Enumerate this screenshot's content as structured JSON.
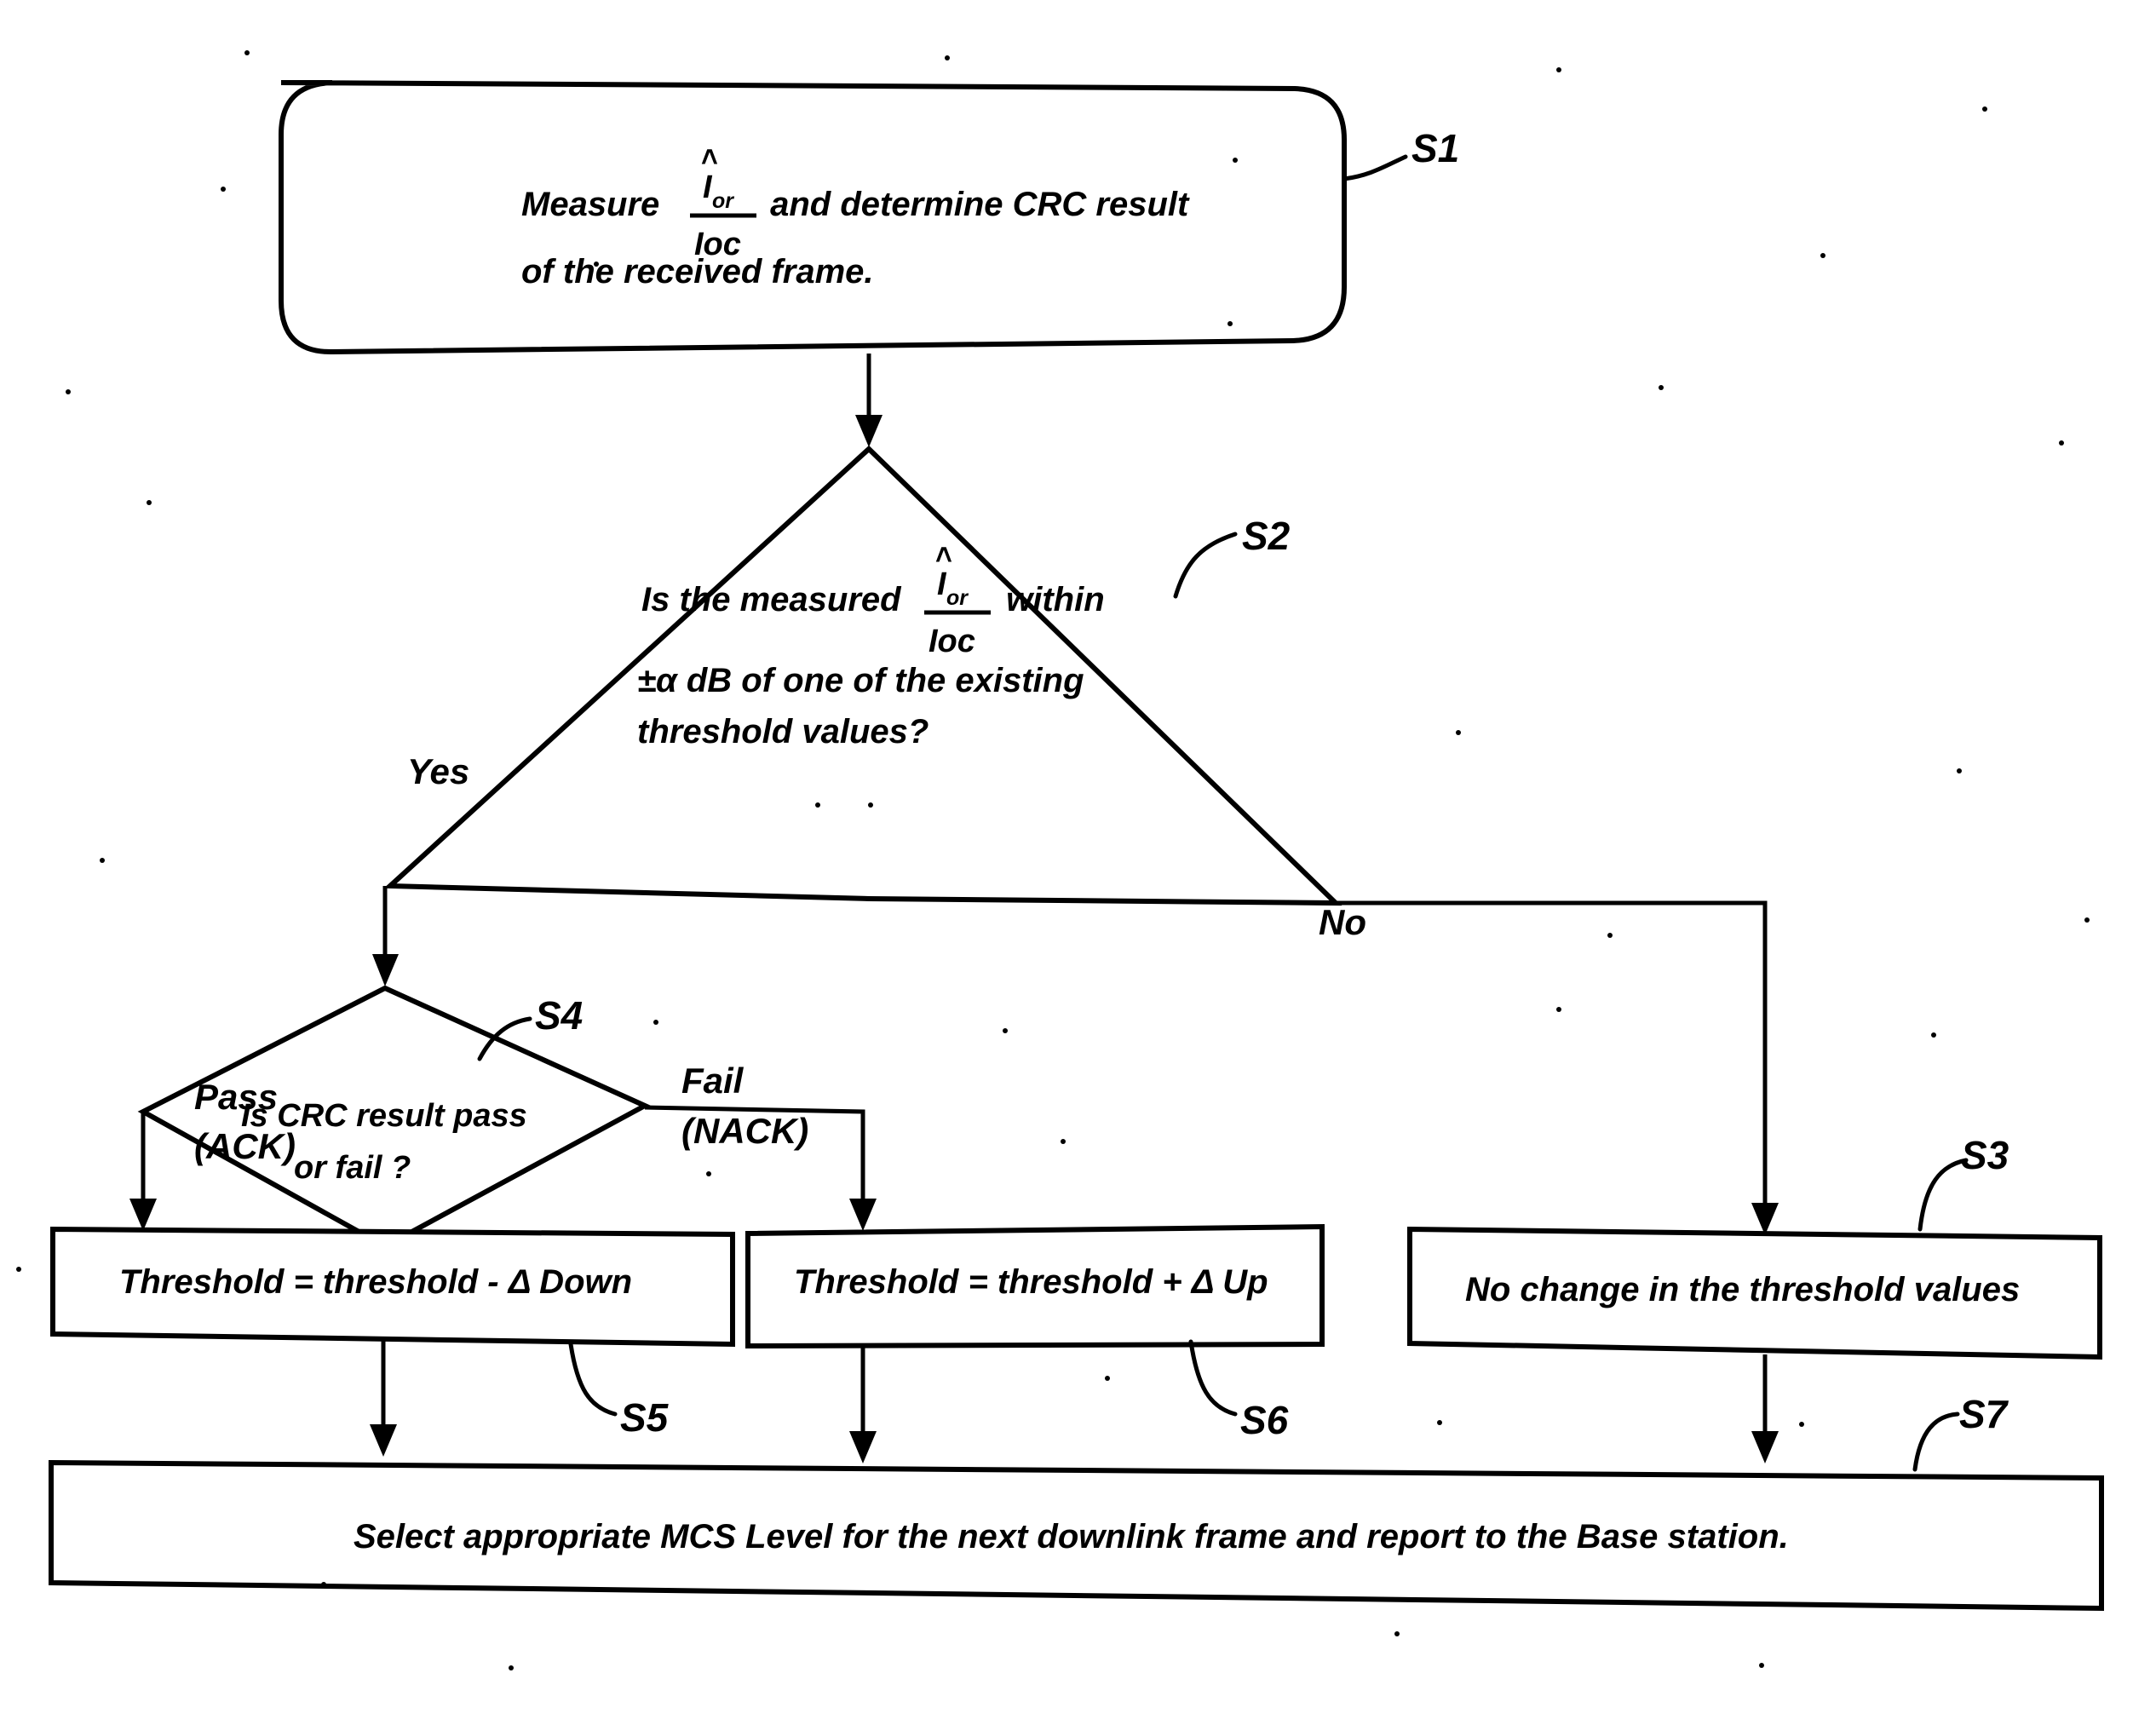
{
  "diagram": {
    "kind": "flowchart",
    "title_present": false,
    "nodes": [
      {
        "id": "S1",
        "step_label": "S1",
        "shape": "rounded-rectangle",
        "lines": [
          {
            "pre": "Measure ",
            "fraction": {
              "numerator": "I",
              "numerator_sub": "or",
              "numerator_hat": true,
              "denominator": "Ioc"
            },
            "post": " and determine CRC result"
          },
          {
            "pre": "of the received frame.",
            "fraction": null,
            "post": ""
          }
        ],
        "plain_text": "Measure Îor/Ioc and determine CRC result of the received frame."
      },
      {
        "id": "S2",
        "step_label": "S2",
        "shape": "diamond",
        "lines": [
          {
            "pre": "Is the measured ",
            "fraction": {
              "numerator": "I",
              "numerator_sub": "or",
              "numerator_hat": true,
              "denominator": "Ioc"
            },
            "post": " within"
          },
          {
            "pre": "±α dB of one of the existing",
            "fraction": null,
            "post": ""
          },
          {
            "pre": "threshold values?",
            "fraction": null,
            "post": ""
          }
        ],
        "plain_text": "Is the measured Îor/Ioc within ±α dB of one of the existing threshold values?"
      },
      {
        "id": "S4",
        "step_label": "S4",
        "shape": "diamond",
        "lines": [
          {
            "pre": "Is CRC result pass",
            "fraction": null,
            "post": ""
          },
          {
            "pre": "or fail ?",
            "fraction": null,
            "post": ""
          }
        ],
        "plain_text": "Is CRC result pass or fail ?"
      },
      {
        "id": "S5",
        "step_label": "S5",
        "shape": "rectangle",
        "lines": [
          {
            "pre": "Threshold = threshold - Δ Down",
            "fraction": null,
            "post": ""
          }
        ],
        "plain_text": "Threshold = threshold - Δ Down"
      },
      {
        "id": "S6",
        "step_label": "S6",
        "shape": "rectangle",
        "lines": [
          {
            "pre": "Threshold = threshold + Δ Up",
            "fraction": null,
            "post": ""
          }
        ],
        "plain_text": "Threshold = threshold + Δ Up"
      },
      {
        "id": "S3",
        "step_label": "S3",
        "shape": "rectangle",
        "lines": [
          {
            "pre": "No change in the threshold values",
            "fraction": null,
            "post": ""
          }
        ],
        "plain_text": "No change in the threshold values"
      },
      {
        "id": "S7",
        "step_label": "S7",
        "shape": "rectangle",
        "lines": [
          {
            "pre": "Select appropriate MCS Level for the next downlink frame and report to the Base station.",
            "fraction": null,
            "post": ""
          }
        ],
        "plain_text": "Select appropriate MCS Level for the next downlink frame and report to the Base station."
      }
    ],
    "edge_labels": {
      "s2_yes": "Yes",
      "s2_no": "No",
      "s4_pass_line1": "Pass",
      "s4_pass_line2": "(ACK)",
      "s4_fail_line1": "Fail",
      "s4_fail_line2": "(NACK)"
    },
    "step_labels": {
      "s1": "S1",
      "s2": "S2",
      "s3": "S3",
      "s4": "S4",
      "s5": "S5",
      "s6": "S6",
      "s7": "S7"
    },
    "text_pieces": {
      "s1_pre": "Measure ",
      "s1_post": " and determine CRC result",
      "s1_line2": "of the received frame.",
      "s2_pre": "Is the measured ",
      "s2_post": " within",
      "s2_line2": "±α dB of one of the existing",
      "s2_line3": "threshold values?",
      "s4_line1": "Is CRC result pass",
      "s4_line2": "or fail ?",
      "s5_text": "Threshold = threshold - Δ Down",
      "s6_text": "Threshold = threshold + Δ Up",
      "s3_text": "No change in the threshold values",
      "s7_text": "Select appropriate MCS Level for the next downlink frame and report to the Base station.",
      "frac_num": "I",
      "frac_num_sub": "or",
      "frac_den": "Ioc",
      "hat": "˄"
    },
    "colors": {
      "stroke": "#000000",
      "fill": "#ffffff",
      "background": "#ffffff"
    }
  }
}
